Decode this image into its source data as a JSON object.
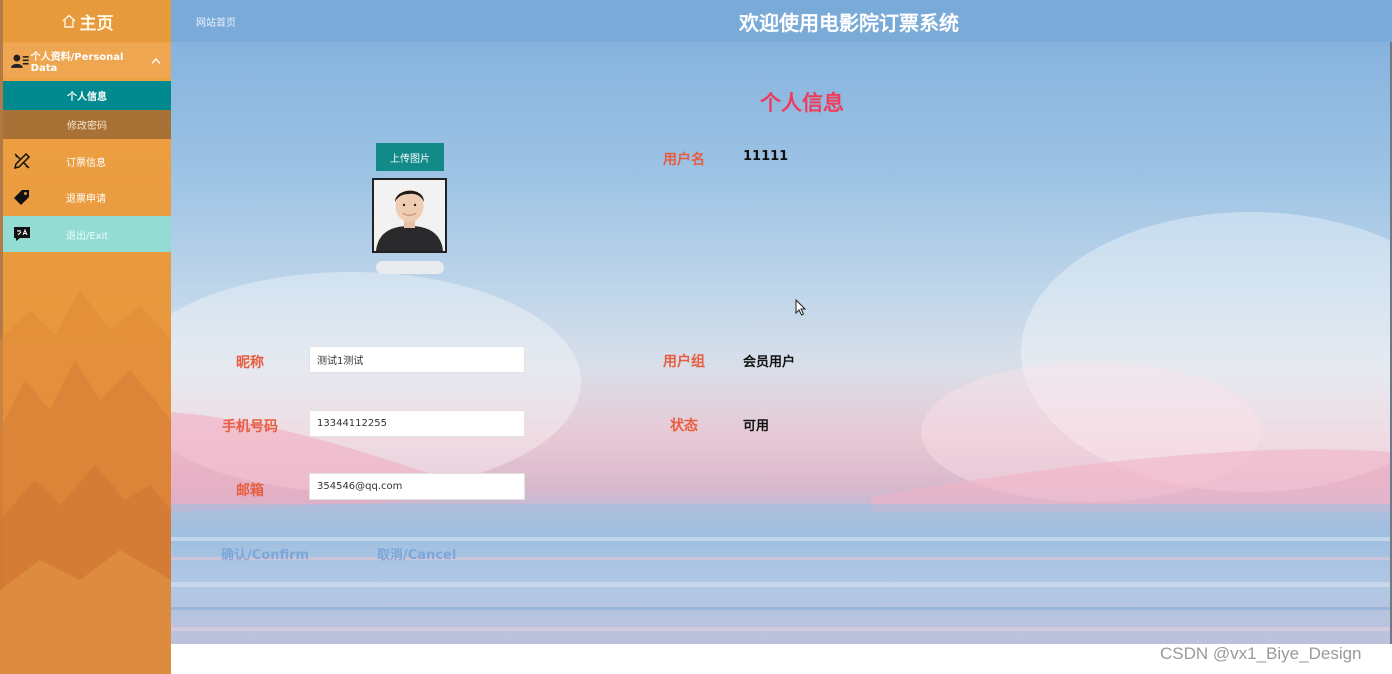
{
  "sidebar": {
    "home_label": "主页",
    "menu_group_label": "个人资料/Personal Data",
    "sub_items": [
      {
        "label": "个人信息",
        "active": true
      },
      {
        "label": "修改密码",
        "active": false
      }
    ],
    "items": [
      {
        "label": "订票信息",
        "icon": "pencil-ruler-icon"
      },
      {
        "label": "退票申请",
        "icon": "tag-icon"
      },
      {
        "label": "退出/Exit",
        "icon": "translate-chat-icon"
      }
    ]
  },
  "header": {
    "site_home": "网站首页",
    "app_title": "欢迎使用电影院订票系统"
  },
  "profile": {
    "page_title": "个人信息",
    "upload_button": "上传图片",
    "fields_left": [
      {
        "label": "昵称",
        "value": "测试1测试"
      },
      {
        "label": "手机号码",
        "value": "13344112255"
      },
      {
        "label": "邮箱",
        "value": "354546@qq.com"
      }
    ],
    "fields_right": [
      {
        "label": "用户名",
        "value": "11111"
      },
      {
        "label": "用户组",
        "value": "会员用户"
      },
      {
        "label": "状态",
        "value": "可用"
      }
    ],
    "confirm_label": "确认/Confirm",
    "cancel_label": "取消/Cancel"
  },
  "watermark": "CSDN @vx1_Biye_Design",
  "colors": {
    "sidebar": "#e8983d",
    "active_item": "#00898e",
    "topbar": "#7aaad8",
    "title_accent": "#ee3c5d",
    "label": "#e85d3f",
    "upload_button": "#118a88"
  }
}
